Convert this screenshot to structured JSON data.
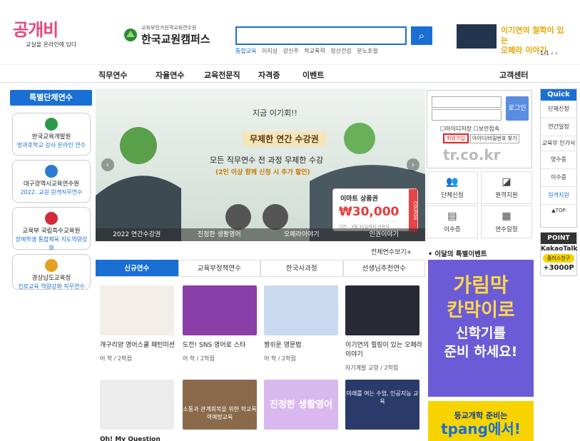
{
  "header": {
    "logo1_title": "공개비",
    "logo1_sub": "교실을 온라인에 담다",
    "logo2_small": "교육부인가원격교육연수원",
    "logo2_main": "한국교원캠퍼스",
    "search_placeholder": "",
    "keywords": [
      "통합교육",
      "이지성",
      "강신주",
      "학교폭력",
      "정신건강",
      "분노조절"
    ],
    "banner_text1": "이기연의 철학이 있는",
    "banner_text2": "오페라 이야기",
    "banner_pager": "1/1"
  },
  "nav": [
    "직무연수",
    "자율연수",
    "교육전문직",
    "자격증",
    "이벤트",
    "고객센터"
  ],
  "left": {
    "title": "특별단체연수",
    "items": [
      {
        "name": "한국교육개발원",
        "desc": "방과후학교 강사 온라인 연수"
      },
      {
        "name": "대구광역시교육연수원",
        "desc": "2022. 교원 원격직무연수"
      },
      {
        "name": "교육부 국립특수교육원",
        "desc": "장애학생 통합체육 지도역량강화"
      },
      {
        "name": "경상남도교육청",
        "desc": "진로교육 역량강화 직무연수"
      }
    ]
  },
  "banner": {
    "t1": "지금 이기회!!",
    "t2": "무제한 연간 수강권",
    "t3": "모든 직무연수 전 과정 무제한 수강",
    "t4": "(2인 이상 함께 신청 시 추가 할인)",
    "coupon_title": "이마트 상품권",
    "coupon_value": "₩30,000",
    "coupon_note": "기간 : 3월 31일까지 신청자",
    "coupon_tag": "COUPON",
    "tabs": [
      "2022 연간수강권",
      "진정한 생활영어",
      "오페라이야기",
      "인권이야기"
    ]
  },
  "more": "전체연수보기+",
  "course_tabs": [
    "신규연수",
    "교육부정책연수",
    "한국사과정",
    "선생님추천연수"
  ],
  "courses": [
    {
      "title": "개구리양 영어스쿨 패턴미션",
      "meta": "어 학 / 2학점"
    },
    {
      "title": "도전! SNS 영어로 스타",
      "meta": "어 학 / 2학점"
    },
    {
      "title": "짱쉬운 영문법",
      "meta": "어 학 / 2학점"
    },
    {
      "title": "이기연의 힐링이 있는 오페라이야기",
      "meta": "자기계발 교양 / 2학점"
    },
    {
      "title": "Oh! My Question",
      "meta": ""
    },
    {
      "title": "소통과 관계회복을 위한 학교폭력예방교육",
      "meta": ""
    },
    {
      "title": "진정한 생활영어",
      "meta": ""
    },
    {
      "title": "미래를 여는 수업, 인공지능 교육",
      "meta": ""
    }
  ],
  "login": {
    "btn": "로그인",
    "save_id": "아이디저장",
    "secure": "보안접속",
    "join": "회원가입",
    "find": "아이디/비밀번호 찾기",
    "short": "tr.co.kr"
  },
  "quick_grid": [
    "단체신청",
    "원격지원",
    "이수증",
    "연수일정"
  ],
  "event_header": "이달의 특별이벤트",
  "event": {
    "l1": "가림막",
    "l2": "칸막이로",
    "l3": "신학기를",
    "l4": "준비 하세요!"
  },
  "event2": {
    "a": "등교개학 준비는",
    "b": "tpang에서!"
  },
  "quick": {
    "title": "Quick",
    "items": [
      "단체신청",
      "연간일정",
      "교육부 인가서",
      "영수증",
      "이수증",
      "원격지원",
      "▲TOP"
    ]
  },
  "point": {
    "title": "POINT",
    "kakao": "KakaoTalk",
    "friend": "플러스친구",
    "plus": "+3000P"
  },
  "colors": {
    "primary": "#1a6fd4",
    "join_border": "#e52020",
    "event_bg": "#6b5bd6"
  }
}
